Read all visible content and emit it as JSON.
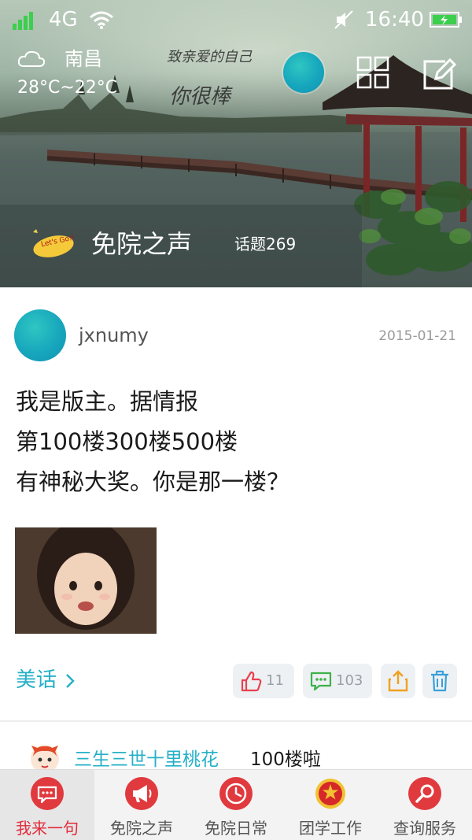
{
  "status_bar": {
    "network": "4G",
    "time": "16:40"
  },
  "header": {
    "weather_icon": "cloud-icon",
    "city": "南昌",
    "temperature": "28°C~22°C",
    "calligraphy_line1": "致亲爱的自己",
    "calligraphy_line2": "你很棒",
    "grid_icon": "grid-icon",
    "compose_icon": "compose-icon"
  },
  "channel": {
    "badge_icon": "lets-go-icon",
    "badge_text": "Let's Go!!",
    "name": "免院之声",
    "topics": "话题269"
  },
  "post": {
    "author": "jxnumy",
    "date": "2015-01-21",
    "lines": [
      "我是版主。据情报",
      "第100楼300楼500楼",
      "有神秘大奖。你是那一楼？"
    ],
    "category": "美话",
    "likes": "11",
    "comments": "103",
    "like_icon": "thumbs-up-icon",
    "comment_icon": "comment-icon",
    "share_icon": "share-icon",
    "delete_icon": "trash-icon"
  },
  "comment_preview": {
    "user": "三生三世十里桃花",
    "text": "100楼啦"
  },
  "tabs": [
    {
      "label": "我来一句",
      "icon": "chat-bubble-icon",
      "active": true
    },
    {
      "label": "免院之声",
      "icon": "megaphone-icon",
      "active": false
    },
    {
      "label": "免院日常",
      "icon": "clock-icon",
      "active": false
    },
    {
      "label": "团学工作",
      "icon": "emblem-icon",
      "active": false
    },
    {
      "label": "查询服务",
      "icon": "search-icon",
      "active": false
    }
  ],
  "colors": {
    "accent": "#26b0c8",
    "tab_active": "#e22b3a",
    "tab_icon_bg": "#e03a3e",
    "like": "#e8414e",
    "comment": "#3fb14a",
    "share": "#f0a020",
    "delete": "#3aa0d8"
  }
}
